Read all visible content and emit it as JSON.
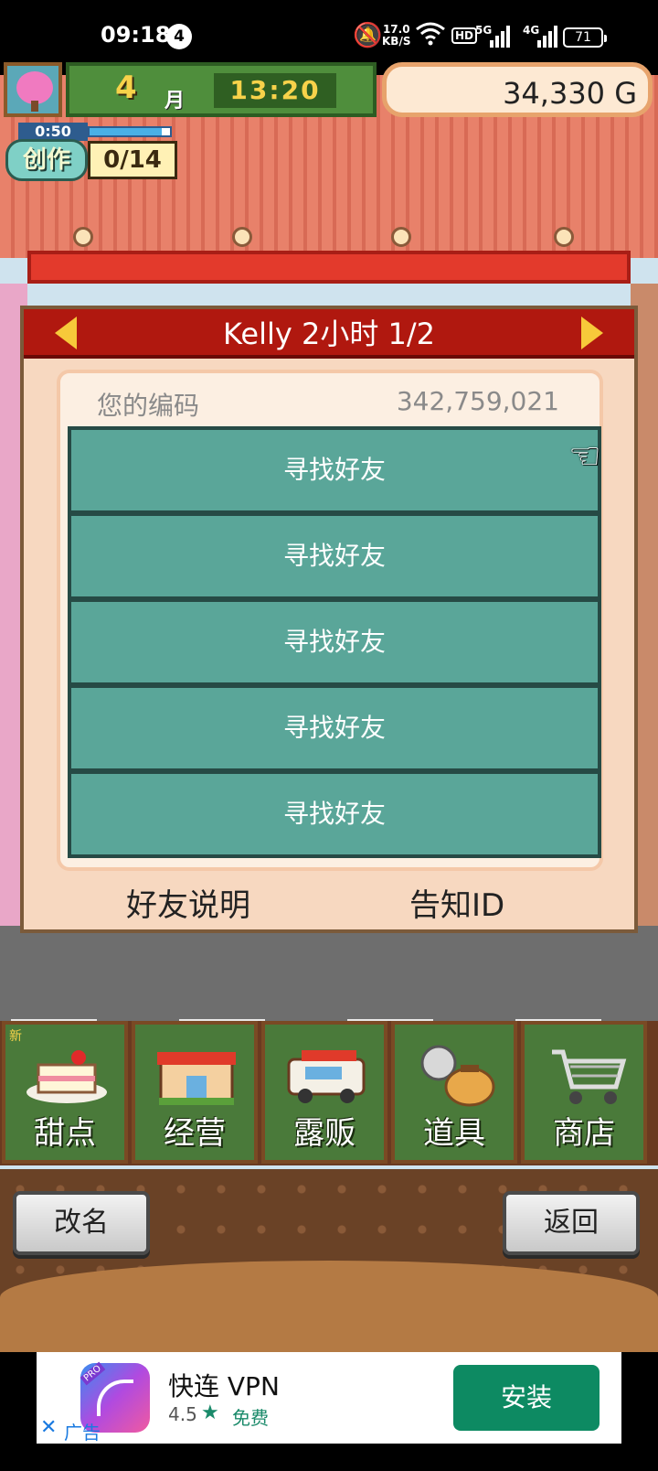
{
  "status_bar": {
    "time": "09:18",
    "notification_count": "4",
    "net_speed_value": "17.0",
    "net_speed_unit": "KB/S",
    "hd_label": "HD",
    "sig1_label": "5G",
    "sig2_label": "4G",
    "battery": "71"
  },
  "hud": {
    "month": "4",
    "month_unit": "月",
    "clock": "13:20",
    "money": "34,330 G",
    "create_timer": "0:50",
    "create_label": "创作",
    "create_count": "0/14",
    "create_progress": 0.9
  },
  "dialog": {
    "title": "Kelly  2小时 1/2",
    "code_label": "您的编码",
    "code_value": "342,759,021",
    "slots": [
      "寻找好友",
      "寻找好友",
      "寻找好友",
      "寻找好友",
      "寻找好友"
    ],
    "friend_help": "好友说明",
    "announce_id": "告知ID"
  },
  "menu": {
    "items": [
      {
        "label": "甜点",
        "icon": "cake-icon",
        "badge": "新"
      },
      {
        "label": "经营",
        "icon": "shop-building-icon"
      },
      {
        "label": "露贩",
        "icon": "food-truck-icon"
      },
      {
        "label": "道具",
        "icon": "item-bag-icon"
      },
      {
        "label": "商店",
        "icon": "shopping-cart-icon"
      }
    ]
  },
  "bottom": {
    "rename": "改名",
    "back": "返回"
  },
  "ad": {
    "app_name": "快连 VPN",
    "rating": "4.5",
    "price": "免费",
    "install": "安装",
    "ad_label": "广告",
    "pro_badge": "PRO"
  },
  "colors": {
    "slot_green": "#5aa699",
    "title_red": "#b0180f",
    "install_green": "#0d8a62"
  }
}
